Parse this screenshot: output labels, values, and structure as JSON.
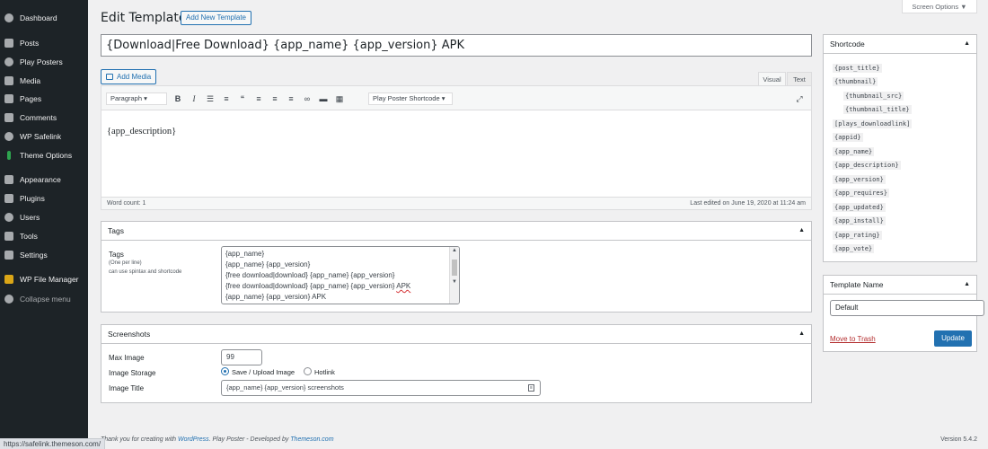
{
  "sidebar": {
    "items": [
      {
        "label": "Dashboard",
        "icon": "dashboard-icon"
      },
      {
        "label": "Posts",
        "icon": "pin-icon"
      },
      {
        "label": "Play Posters",
        "icon": "gears-icon"
      },
      {
        "label": "Media",
        "icon": "media-icon"
      },
      {
        "label": "Pages",
        "icon": "pages-icon"
      },
      {
        "label": "Comments",
        "icon": "comments-icon"
      },
      {
        "label": "WP Safelink",
        "icon": "gears-icon"
      },
      {
        "label": "Theme Options",
        "icon": "theme-options-icon"
      },
      {
        "label": "Appearance",
        "icon": "brush-icon"
      },
      {
        "label": "Plugins",
        "icon": "plugin-icon"
      },
      {
        "label": "Users",
        "icon": "users-icon"
      },
      {
        "label": "Tools",
        "icon": "wrench-icon"
      },
      {
        "label": "Settings",
        "icon": "settings-icon"
      },
      {
        "label": "WP File Manager",
        "icon": "folder-icon"
      },
      {
        "label": "Collapse menu",
        "icon": "collapse-icon"
      }
    ]
  },
  "header": {
    "title": "Edit Template",
    "add_new": "Add New Template",
    "screen_options": "Screen Options ▼"
  },
  "post_title": "{Download|Free Download} {app_name} {app_version} APK",
  "editor": {
    "add_media": "Add Media",
    "tab_visual": "Visual",
    "tab_text": "Text",
    "format": "Paragraph ▾",
    "shortcode_select": "Play Poster Shortcode ▾",
    "content": "{app_description}",
    "word_count": "Word count: 1",
    "last_edited": "Last edited on June 19, 2020 at 11:24 am",
    "toolbar_icons": [
      "bold-icon",
      "italic-icon",
      "bullet-list-icon",
      "numbered-list-icon",
      "blockquote-icon",
      "align-left-icon",
      "align-center-icon",
      "align-right-icon",
      "link-icon",
      "more-tag-icon",
      "toolbar-toggle-icon",
      "fullscreen-icon"
    ]
  },
  "tags": {
    "title": "Tags",
    "label": "Tags",
    "sub1": "(One per line)",
    "sub2": "can use spintax and shortcode",
    "lines": [
      "{app_name}",
      "{app_name} {app_version}",
      "{free download|download} {app_name} {app_version}",
      "{free download|download} {app_name} {app_version} ",
      "{app_name} {app_version} APK"
    ],
    "line4_apk": "APK"
  },
  "screenshots": {
    "title": "Screenshots",
    "max_image_label": "Max Image",
    "max_image_value": "99",
    "storage_label": "Image Storage",
    "storage_option1": "Save / Upload Image",
    "storage_option2": "Hotlink",
    "image_title_label": "Image Title",
    "image_title_value": "{app_name} {app_version} screenshots"
  },
  "shortcode": {
    "title": "Shortcode",
    "items": [
      "{post_title}",
      "{thumbnail}",
      "{thumbnail_src}",
      "{thumbnail_title}",
      "[plays_downloadlink]",
      "{appid}",
      "{app_name}",
      "{app_description}",
      "{app_version}",
      "{app_requires}",
      "{app_updated}",
      "{app_install}",
      "{app_rating}",
      "{app_vote}"
    ]
  },
  "template_name": {
    "title": "Template Name",
    "value": "Default",
    "move_trash": "Move to Trash",
    "update": "Update"
  },
  "footer": {
    "thanks": "Thank you for creating with ",
    "wordpress": "WordPress",
    "play_poster": ". Play Poster - Developed by ",
    "themeson": "Themeson.com",
    "version": "Version 5.4.2",
    "status_url": "https://safelink.themeson.com/"
  },
  "colors": {
    "sidebar_bg": "#1d2327",
    "accent": "#2271b1",
    "trash": "#b32d2e"
  }
}
